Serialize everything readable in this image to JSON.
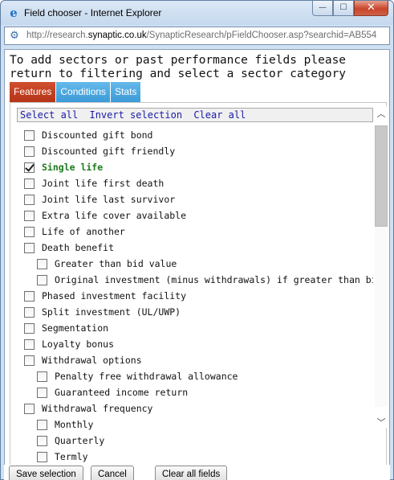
{
  "window": {
    "title": "Field chooser - Internet Explorer",
    "minimize": "—",
    "maximize": "☐",
    "close": "✕"
  },
  "address": {
    "prefix": "http://research.",
    "host": "synaptic.co.uk",
    "path": "/SynapticResearch/pFieldChooser.asp?searchid=AB554"
  },
  "instructions": "To add sectors or past performance fields please return to filtering and select a sector category",
  "tabs": [
    {
      "label": "Features",
      "active": true
    },
    {
      "label": "Conditions",
      "active": false
    },
    {
      "label": "Stats",
      "active": false
    }
  ],
  "toolbar": {
    "select_all": "Select all",
    "invert_selection": "Invert selection",
    "clear_all": "Clear all"
  },
  "fields": [
    {
      "label": "Discounted gift bond",
      "checked": false,
      "indent": 0
    },
    {
      "label": "Discounted gift friendly",
      "checked": false,
      "indent": 0
    },
    {
      "label": "Single life",
      "checked": true,
      "indent": 0
    },
    {
      "label": "Joint life first death",
      "checked": false,
      "indent": 0
    },
    {
      "label": "Joint life last survivor",
      "checked": false,
      "indent": 0
    },
    {
      "label": "Extra life cover available",
      "checked": false,
      "indent": 0
    },
    {
      "label": "Life of another",
      "checked": false,
      "indent": 0
    },
    {
      "label": "Death benefit",
      "checked": false,
      "indent": 0
    },
    {
      "label": "Greater than bid value",
      "checked": false,
      "indent": 1
    },
    {
      "label": "Original investment (minus withdrawals) if greater than bid value",
      "checked": false,
      "indent": 1
    },
    {
      "label": "Phased investment facility",
      "checked": false,
      "indent": 0
    },
    {
      "label": "Split investment (UL/UWP)",
      "checked": false,
      "indent": 0
    },
    {
      "label": "Segmentation",
      "checked": false,
      "indent": 0
    },
    {
      "label": "Loyalty bonus",
      "checked": false,
      "indent": 0
    },
    {
      "label": "Withdrawal options",
      "checked": false,
      "indent": 0
    },
    {
      "label": "Penalty free withdrawal allowance",
      "checked": false,
      "indent": 1
    },
    {
      "label": "Guaranteed income return",
      "checked": false,
      "indent": 1
    },
    {
      "label": "Withdrawal frequency",
      "checked": false,
      "indent": 0
    },
    {
      "label": "Monthly",
      "checked": false,
      "indent": 1
    },
    {
      "label": "Quarterly",
      "checked": false,
      "indent": 1
    },
    {
      "label": "Termly",
      "checked": false,
      "indent": 1
    }
  ],
  "buttons": {
    "save": "Save selection",
    "cancel": "Cancel",
    "clear_fields": "Clear all fields"
  },
  "icons": {
    "browser": "ie-logo-icon",
    "page": "page-icon",
    "scroll_up": "chevron-up-icon",
    "scroll_down": "chevron-down-icon"
  }
}
